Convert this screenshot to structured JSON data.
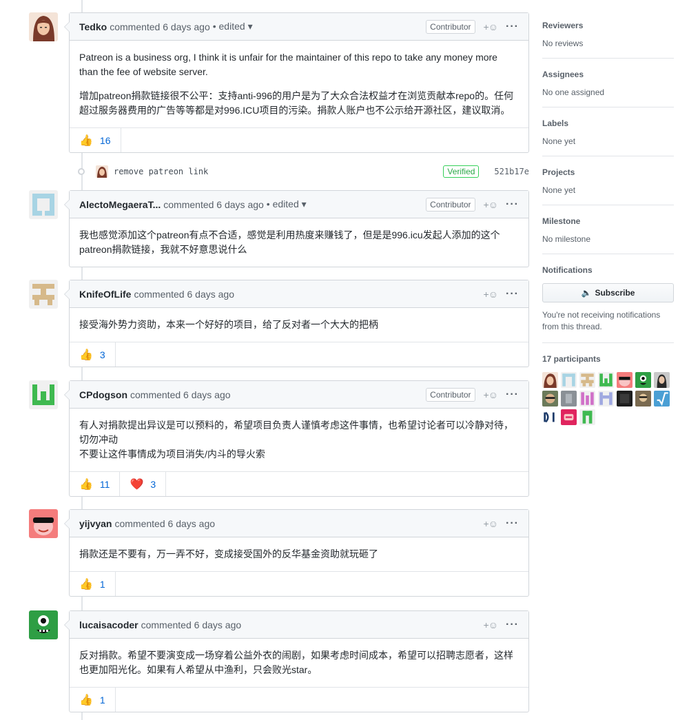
{
  "comments": [
    {
      "author": "Tedko",
      "meta": "commented 6 days ago",
      "edited": "• edited",
      "badge": "Contributor",
      "body": [
        "Patreon is a business org, I think it is unfair for the maintainer of this repo to take any money more than the fee of website server.",
        "增加patreon捐款链接很不公平：支持anti-996的用户是为了大众合法权益才在浏览贡献本repo的。任何超过服务器费用的广告等等都是对996.ICU项目的污染。捐款人账户也不公示给开源社区，建议取消。"
      ],
      "reactions": [
        {
          "emoji": "👍",
          "count": "16"
        }
      ]
    },
    {
      "author": "AlectoMegaeraT...",
      "meta": "commented 6 days ago",
      "edited": "• edited",
      "badge": "Contributor",
      "body": [
        "我也感觉添加这个patreon有点不合适，感觉是利用热度来赚钱了，但是是996.icu发起人添加的这个patreon捐款链接，我就不好意思说什么"
      ],
      "reactions": []
    },
    {
      "author": "KnifeOfLife",
      "meta": "commented 6 days ago",
      "body": [
        "接受海外势力资助，本来一个好好的项目，给了反对者一个大大的把柄"
      ],
      "reactions": [
        {
          "emoji": "👍",
          "count": "3"
        }
      ]
    },
    {
      "author": "CPdogson",
      "meta": "commented 6 days ago",
      "badge": "Contributor",
      "body": [
        "有人对捐款提出异议是可以预料的，希望项目负责人谨慎考虑这件事情，也希望讨论者可以冷静对待，切勿冲动",
        "不要让这件事情成为项目消失/内斗的导火索"
      ],
      "reactions": [
        {
          "emoji": "👍",
          "count": "11"
        },
        {
          "emoji": "❤️",
          "count": "3"
        }
      ]
    },
    {
      "author": "yijvyan",
      "meta": "commented 6 days ago",
      "body": [
        "捐款还是不要有，万一弄不好，变成接受国外的反华基金资助就玩砸了"
      ],
      "reactions": [
        {
          "emoji": "👍",
          "count": "1"
        }
      ]
    },
    {
      "author": "lucaisacoder",
      "meta": "commented 6 days ago",
      "body": [
        "反对捐款。希望不要演变成一场穿着公益外衣的闹剧，如果考虑时间成本，希望可以招聘志愿者，这样也更加阳光化。如果有人希望从中渔利，只会败光star。"
      ],
      "reactions": [
        {
          "emoji": "👍",
          "count": "1"
        }
      ]
    }
  ],
  "commit": {
    "message": "remove patreon link",
    "verified": "Verified",
    "sha": "521b17e"
  },
  "header_actions": {
    "react": "+☺",
    "more": "···"
  },
  "sidebar": {
    "reviewers": {
      "heading": "Reviewers",
      "value": "No reviews"
    },
    "assignees": {
      "heading": "Assignees",
      "value": "No one assigned"
    },
    "labels": {
      "heading": "Labels",
      "value": "None yet"
    },
    "projects": {
      "heading": "Projects",
      "value": "None yet"
    },
    "milestone": {
      "heading": "Milestone",
      "value": "No milestone"
    },
    "notifications": {
      "heading": "Notifications",
      "button": "Subscribe",
      "note": "You're not receiving notifications from this thread."
    },
    "participants": {
      "heading": "17 participants"
    }
  },
  "colors": {
    "link": "#0366d6",
    "verified": "#28a745",
    "border": "#d1d5da"
  }
}
